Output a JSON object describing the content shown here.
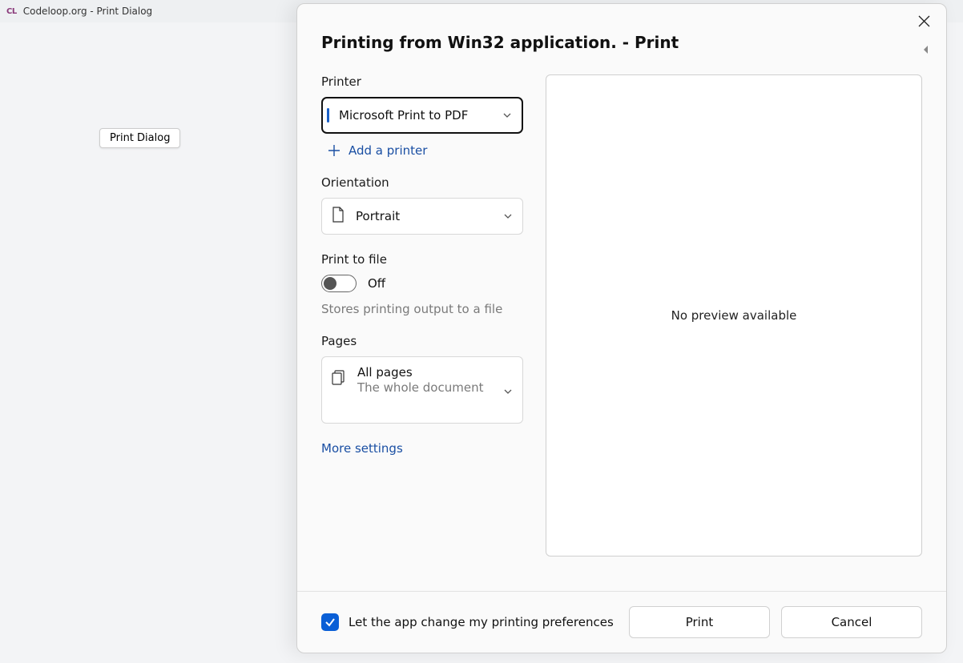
{
  "app": {
    "logoText": "CL",
    "title": "Codeloop.org - Print Dialog",
    "bgButton": "Print Dialog"
  },
  "dialog": {
    "title": "Printing from Win32 application. - Print",
    "printer": {
      "label": "Printer",
      "selected": "Microsoft Print to PDF",
      "addLink": "Add a printer"
    },
    "orientation": {
      "label": "Orientation",
      "selected": "Portrait"
    },
    "printToFile": {
      "label": "Print to file",
      "value": "Off",
      "hint": "Stores printing output to a file"
    },
    "pages": {
      "label": "Pages",
      "primary": "All pages",
      "secondary": "The whole document"
    },
    "moreSettings": "More settings",
    "preview": {
      "message": "No preview available"
    },
    "footer": {
      "checkbox": "Let the app change my printing preferences",
      "printBtn": "Print",
      "cancelBtn": "Cancel"
    }
  }
}
